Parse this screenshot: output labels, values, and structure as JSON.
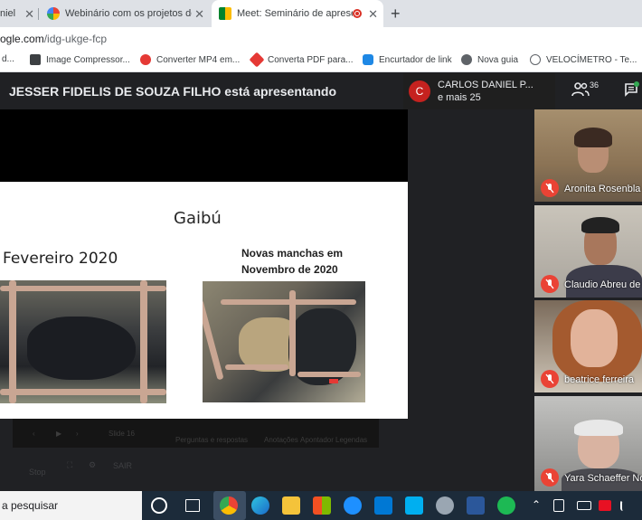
{
  "browser": {
    "tabs": [
      {
        "title": "niel",
        "active": false
      },
      {
        "title": "Webinário com os projetos do Ed",
        "active": false
      },
      {
        "title": "Meet: Seminário de apresent",
        "active": true
      }
    ],
    "address": {
      "host": "ogle.com",
      "path": "/idg-ukge-fcp"
    },
    "bookmarks": [
      "d...",
      "Image Compressor...",
      "Converter MP4 em...",
      "Converta PDF para...",
      "Encurtador de link",
      "Nova guia",
      "VELOCÍMETRO - Te..."
    ]
  },
  "meet": {
    "presenting_banner": "JESSER FIDELIS DE SOUZA FILHO está apresentando",
    "presenter_chip": {
      "initial": "C",
      "name": "CARLOS DANIEL P...",
      "others": "e mais 25"
    },
    "people_count": "36",
    "slide": {
      "title": "Gaibú",
      "left_caption": "Fevereiro 2020",
      "right_caption_line1": "Novas manchas em",
      "right_caption_line2": "Novembro de 2020"
    },
    "slide_controls": {
      "slide_label": "Slide 16",
      "questions": "Perguntas e respostas",
      "annotations": "Anotações",
      "pointer": "Apontador",
      "captions": "Legendas",
      "exit": "SAIR",
      "stop": "Stop"
    },
    "participants": [
      {
        "name": "Aronita Rosenbla",
        "muted": true
      },
      {
        "name": "Claudio Abreu de",
        "muted": true
      },
      {
        "name": "beatrice ferreira",
        "muted": true
      },
      {
        "name": "Yara Schaeffer No",
        "muted": true
      }
    ]
  },
  "taskbar": {
    "search_text": "a pesquisar"
  },
  "colors": {
    "meet_background": "#202124",
    "mute_red": "#ea4335",
    "avatar_red": "#c5221f",
    "taskbar": "#1c2b3a"
  }
}
